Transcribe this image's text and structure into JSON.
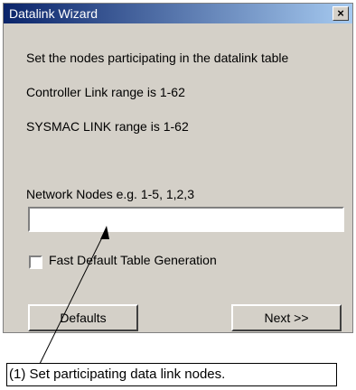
{
  "window": {
    "title": "Datalink Wizard",
    "close_glyph": "×"
  },
  "texts": {
    "line1": "Set the nodes participating in the datalink table",
    "line2": "Controller Link range is 1-62",
    "line3": "SYSMAC LINK range is 1-62",
    "nodes_label": "Network Nodes  e.g. 1-5, 1,2,3"
  },
  "nodes_input": {
    "value": ""
  },
  "fast_default": {
    "label": "Fast Default Table Generation",
    "checked": false
  },
  "buttons": {
    "defaults": "Defaults",
    "next": "Next  >>"
  },
  "callout": {
    "text": "(1) Set participating data link nodes."
  }
}
